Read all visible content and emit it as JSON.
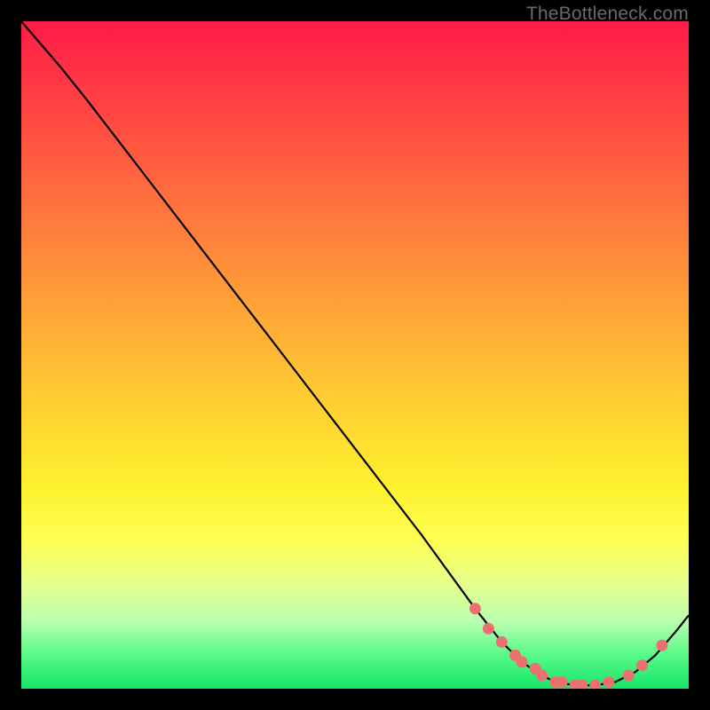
{
  "watermark": "TheBottleneck.com",
  "colors": {
    "line": "#000000",
    "marker_fill": "#ed7070",
    "marker_stroke": "#ed7070",
    "gradient_top": "#ff1b47",
    "gradient_bottom": "#17e66b"
  },
  "chart_data": {
    "type": "line",
    "title": "",
    "xlabel": "",
    "ylabel": "",
    "xlim": [
      0,
      100
    ],
    "ylim": [
      0,
      100
    ],
    "grid": false,
    "note": "No numeric axis ticks are shown in the image; y values are estimated from vertical pixel position (0 = bottom, 100 = top).",
    "series": [
      {
        "name": "curve",
        "kind": "line",
        "x": [
          0,
          6,
          10,
          20,
          30,
          40,
          50,
          60,
          68,
          72,
          75,
          78,
          80,
          83,
          86,
          89,
          92,
          95,
          98,
          100
        ],
        "y": [
          100,
          93,
          88,
          75,
          62,
          49,
          36,
          23,
          12,
          7,
          4,
          2,
          1,
          0.5,
          0.5,
          1,
          2.5,
          5,
          8.5,
          11
        ]
      },
      {
        "name": "highlight-dots",
        "kind": "scatter",
        "x": [
          68,
          70,
          72,
          74,
          75,
          77,
          78,
          80,
          81,
          83,
          84,
          86,
          88,
          91,
          93,
          96
        ],
        "y": [
          12,
          9,
          7,
          5,
          4,
          3,
          2,
          1,
          1,
          0.5,
          0.5,
          0.5,
          1,
          2,
          3.5,
          6.5
        ]
      }
    ]
  }
}
